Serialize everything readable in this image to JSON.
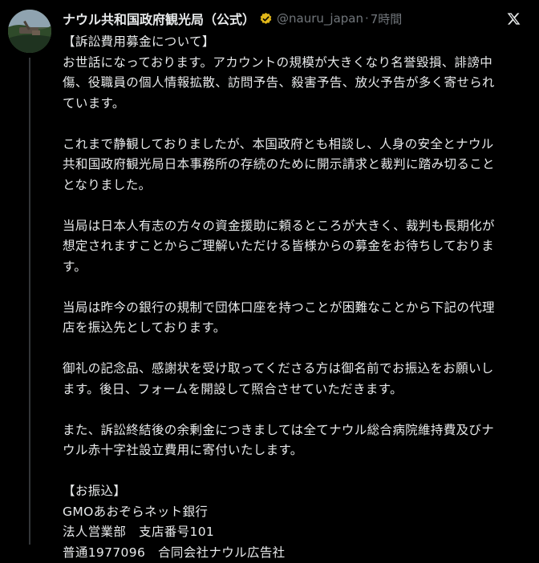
{
  "tweet": {
    "display_name": "ナウル共和国政府観光局（公式）",
    "handle": "@nauru_japan",
    "separator": "·",
    "time": "7時間",
    "badge_icon": "gold-verified-badge-icon",
    "platform_icon": "x-logo-icon",
    "paragraphs": [
      "【訴訟費用募金について】\nお世話になっております。アカウントの規模が大きくなり名誉毀損、誹謗中\n傷、役職員の個人情報拡散、訪問予告、殺害予告、放火予告が多く寄せられ\nています。",
      "これまで静観しておりましたが、本国政府とも相談し、人身の安全とナウル\n共和国政府観光局日本事務所の存続のために開示請求と裁判に踏み切ること\nとなりました。",
      "当局は日本人有志の方々の資金援助に頼るところが大きく、裁判も長期化が\n想定されますことからご理解いただける皆様からの募金をお待ちしておりま\nす。",
      "当局は昨今の銀行の規制で団体口座を持つことが困難なことから下記の代理\n店を振込先としております。",
      "御礼の記念品、感謝状を受け取ってくださる方は御名前でお振込をお願いし\nます。後日、フォームを開設して照合させていただきます。",
      "また、訴訟終結後の余剰金につきましては全てナウル総合病院維持費及びナ\nウル赤十字社設立費用に寄付いたします。",
      "【お振込】\nGMOあおぞらネット銀行\n法人営業部　支店番号101\n普通1977096　合同会社ナウル広告社"
    ]
  },
  "colors": {
    "background": "#000000",
    "text": "#e7e9ea",
    "secondary_text": "#71767b",
    "badge_gold": "#e2b719"
  }
}
